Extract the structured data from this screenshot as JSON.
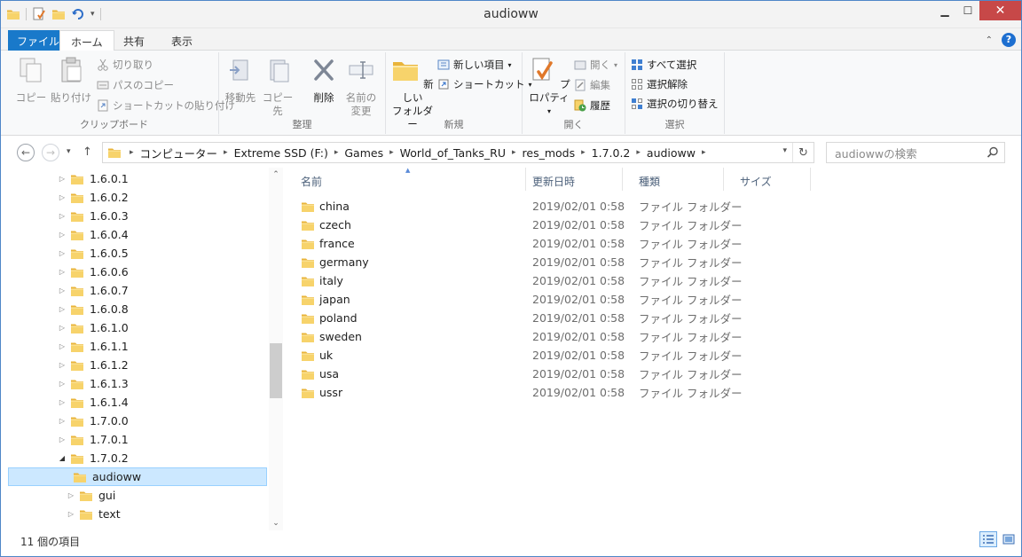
{
  "window": {
    "title": "audioww"
  },
  "tabs": {
    "file": "ファイル",
    "home": "ホーム",
    "share": "共有",
    "view": "表示"
  },
  "ribbon": {
    "clipboard": {
      "label": "クリップボード",
      "copy": "コピー",
      "paste": "貼り付け",
      "cut": "切り取り",
      "copy_path": "パスのコピー",
      "paste_shortcut": "ショートカットの貼り付け"
    },
    "organize": {
      "label": "整理",
      "move_to": "移動先",
      "copy_to": "コピー先",
      "delete": "削除",
      "rename_1": "名前の",
      "rename_2": "変更"
    },
    "new": {
      "label": "新規",
      "new_folder_1": "新しい",
      "new_folder_2": "フォルダー",
      "new_item": "新しい項目",
      "easy_access": "ショートカット"
    },
    "open": {
      "label": "開く",
      "properties": "プロパティ",
      "open": "開く",
      "edit": "編集",
      "history": "履歴"
    },
    "select": {
      "label": "選択",
      "select_all": "すべて選択",
      "select_none": "選択解除",
      "invert": "選択の切り替え"
    }
  },
  "address": {
    "crumbs": [
      "コンピューター",
      "Extreme SSD (F:)",
      "Games",
      "World_of_Tanks_RU",
      "res_mods",
      "1.7.0.2",
      "audioww"
    ],
    "search_placeholder": "audiowwの検索"
  },
  "tree": [
    {
      "label": "1.6.0.1"
    },
    {
      "label": "1.6.0.2"
    },
    {
      "label": "1.6.0.3"
    },
    {
      "label": "1.6.0.4"
    },
    {
      "label": "1.6.0.5"
    },
    {
      "label": "1.6.0.6"
    },
    {
      "label": "1.6.0.7"
    },
    {
      "label": "1.6.0.8"
    },
    {
      "label": "1.6.1.0"
    },
    {
      "label": "1.6.1.1"
    },
    {
      "label": "1.6.1.2"
    },
    {
      "label": "1.6.1.3"
    },
    {
      "label": "1.6.1.4"
    },
    {
      "label": "1.7.0.0"
    },
    {
      "label": "1.7.0.1"
    },
    {
      "label": "1.7.0.2"
    },
    {
      "label": "audioww"
    },
    {
      "label": "gui"
    },
    {
      "label": "text"
    }
  ],
  "columns": {
    "name": "名前",
    "date": "更新日時",
    "type": "種類",
    "size": "サイズ"
  },
  "files": [
    {
      "name": "china",
      "date": "2019/02/01 0:58",
      "type": "ファイル フォルダー"
    },
    {
      "name": "czech",
      "date": "2019/02/01 0:58",
      "type": "ファイル フォルダー"
    },
    {
      "name": "france",
      "date": "2019/02/01 0:58",
      "type": "ファイル フォルダー"
    },
    {
      "name": "germany",
      "date": "2019/02/01 0:58",
      "type": "ファイル フォルダー"
    },
    {
      "name": "italy",
      "date": "2019/02/01 0:58",
      "type": "ファイル フォルダー"
    },
    {
      "name": "japan",
      "date": "2019/02/01 0:58",
      "type": "ファイル フォルダー"
    },
    {
      "name": "poland",
      "date": "2019/02/01 0:58",
      "type": "ファイル フォルダー"
    },
    {
      "name": "sweden",
      "date": "2019/02/01 0:58",
      "type": "ファイル フォルダー"
    },
    {
      "name": "uk",
      "date": "2019/02/01 0:58",
      "type": "ファイル フォルダー"
    },
    {
      "name": "usa",
      "date": "2019/02/01 0:58",
      "type": "ファイル フォルダー"
    },
    {
      "name": "ussr",
      "date": "2019/02/01 0:58",
      "type": "ファイル フォルダー"
    }
  ],
  "status": {
    "count": "11 個の項目"
  },
  "colors": {
    "accent": "#1979ca",
    "selection": "#cce8ff",
    "close": "#c74848",
    "folder": "#f5c84c"
  }
}
